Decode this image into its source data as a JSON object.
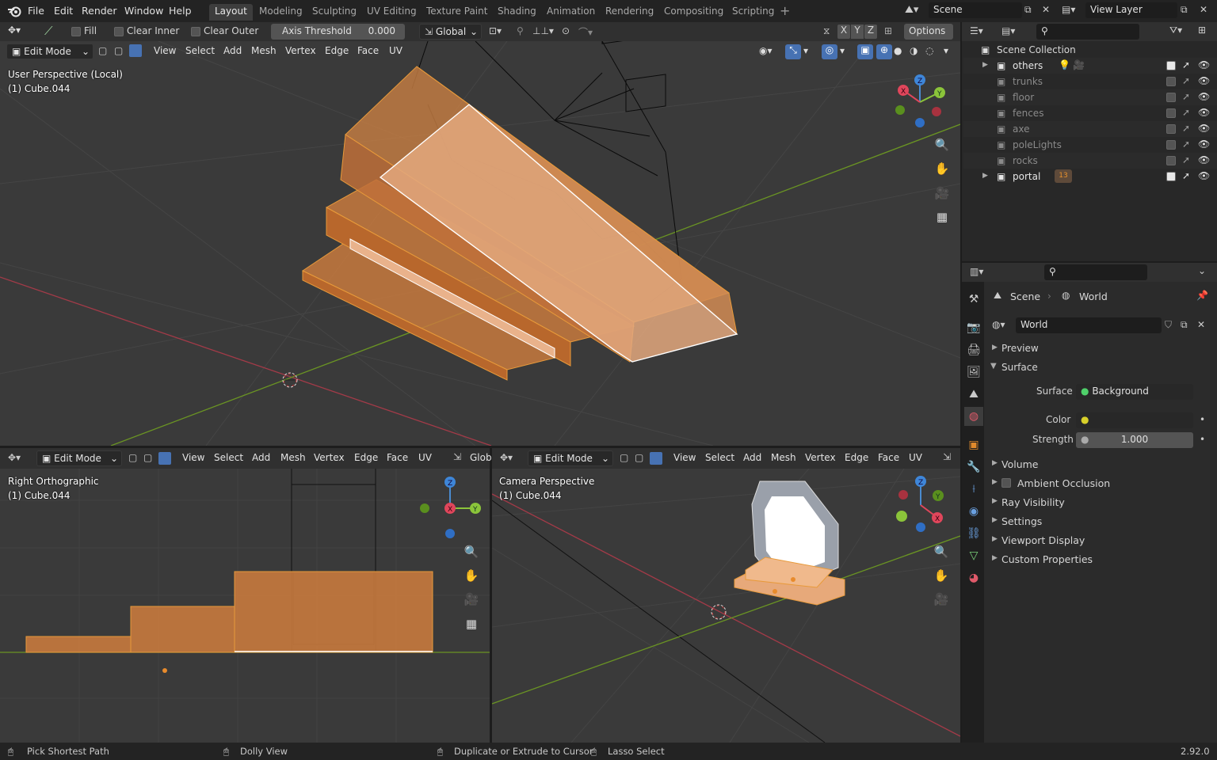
{
  "app": {
    "logo": "blender-logo",
    "version": "2.92.0"
  },
  "menu": [
    "File",
    "Edit",
    "Render",
    "Window",
    "Help"
  ],
  "workspaces": [
    {
      "label": "Layout",
      "active": true
    },
    {
      "label": "Modeling"
    },
    {
      "label": "Sculpting"
    },
    {
      "label": "UV Editing"
    },
    {
      "label": "Texture Paint"
    },
    {
      "label": "Shading"
    },
    {
      "label": "Animation"
    },
    {
      "label": "Rendering"
    },
    {
      "label": "Compositing"
    },
    {
      "label": "Scripting"
    }
  ],
  "scene": {
    "name": "Scene",
    "view_layer": "View Layer"
  },
  "tool_settings": {
    "fill": "Fill",
    "clear_inner": "Clear Inner",
    "clear_outer": "Clear Outer",
    "axis_threshold_label": "Axis Threshold",
    "axis_threshold_value": "0.000",
    "orientation": "Global",
    "axes": [
      "X",
      "Y",
      "Z"
    ],
    "options": "Options"
  },
  "viewport_header": {
    "mode": "Edit Mode",
    "menus": [
      "View",
      "Select",
      "Add",
      "Mesh",
      "Vertex",
      "Edge",
      "Face",
      "UV"
    ],
    "orientation_short": "Glob"
  },
  "viewports": {
    "main": {
      "title": "User Perspective (Local)",
      "object": "(1) Cube.044"
    },
    "bottom_left": {
      "title": "Right Orthographic",
      "object": "(1) Cube.044"
    },
    "bottom_right": {
      "title": "Camera Perspective",
      "object": "(1) Cube.044"
    }
  },
  "gizmo": {
    "x": "X",
    "y": "Y",
    "z": "Z"
  },
  "outliner": {
    "root": "Scene Collection",
    "collections": [
      {
        "name": "others",
        "enabled": true,
        "expandable": true
      },
      {
        "name": "trunks",
        "enabled": false
      },
      {
        "name": "floor",
        "enabled": false
      },
      {
        "name": "fences",
        "enabled": false
      },
      {
        "name": "axe",
        "enabled": false
      },
      {
        "name": "poleLights",
        "enabled": false
      },
      {
        "name": "rocks",
        "enabled": false
      },
      {
        "name": "portal",
        "enabled": true,
        "expandable": true,
        "badge": "13"
      }
    ]
  },
  "properties": {
    "breadcrumb": [
      "Scene",
      "World"
    ],
    "world_name": "World",
    "panels": {
      "preview": "Preview",
      "surface": "Surface",
      "volume": "Volume",
      "ambient_occlusion": "Ambient Occlusion",
      "ray_visibility": "Ray Visibility",
      "settings": "Settings",
      "viewport_display": "Viewport Display",
      "custom_properties": "Custom Properties"
    },
    "surface": {
      "surface_label": "Surface",
      "surface_value": "Background",
      "color_label": "Color",
      "strength_label": "Strength",
      "strength_value": "1.000"
    }
  },
  "statusbar": {
    "left": "Pick Shortest Path",
    "middle": "Dolly View",
    "right1": "Duplicate or Extrude to Cursor",
    "right2": "Lasso Select"
  },
  "colors": {
    "accent": "#4772b3",
    "select_orange": "#e88b2c",
    "x_axis": "#c8384a",
    "y_axis": "#6e9a1f"
  }
}
